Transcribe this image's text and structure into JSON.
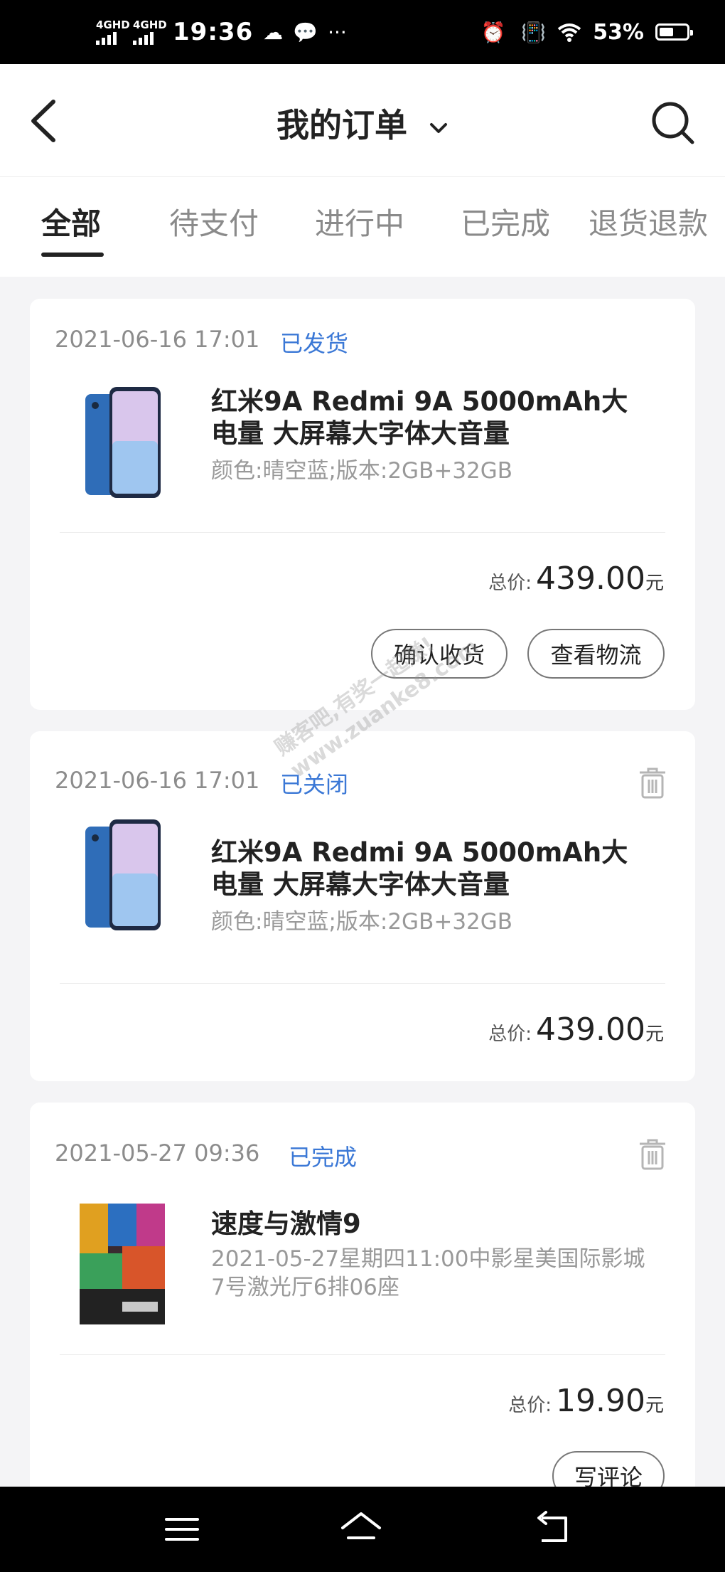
{
  "status_bar": {
    "net1": "4GHD",
    "net2": "4GHD",
    "time": "19:36",
    "battery": "53%"
  },
  "header": {
    "title": "我的订单"
  },
  "tabs": [
    {
      "label": "全部",
      "active": true
    },
    {
      "label": "待支付"
    },
    {
      "label": "进行中"
    },
    {
      "label": "已完成"
    },
    {
      "label": "退货退款"
    }
  ],
  "orders": [
    {
      "date": "2021-06-16 17:01",
      "status": "已发货",
      "name": "红米9A Redmi 9A  5000mAh大电量 大屏幕大字体大音量",
      "spec": "颜色:晴空蓝;版本:2GB+32GB",
      "total_label": "总价:",
      "total": "439.00",
      "unit": "元",
      "buttons": [
        "确认收货",
        "查看物流"
      ]
    },
    {
      "date": "2021-06-16 17:01",
      "status": "已关闭",
      "name": "红米9A Redmi 9A  5000mAh大电量 大屏幕大字体大音量",
      "spec": "颜色:晴空蓝;版本:2GB+32GB",
      "total_label": "总价:",
      "total": "439.00",
      "unit": "元"
    },
    {
      "date": "2021-05-27 09:36",
      "status": "已完成",
      "name": "速度与激情9",
      "spec": "2021-05-27星期四11:00中影星美国际影城7号激光厅6排06座",
      "total_label": "总价:",
      "total": "19.90",
      "unit": "元",
      "buttons": [
        "写评论"
      ]
    }
  ],
  "watermark": {
    "line1": "赚客吧,有奖一起赚!",
    "line2": "www.zuanke8.com"
  },
  "colors": {
    "status_blue": "#3b78d6",
    "text_dark": "#222222",
    "text_gray": "#999999",
    "background": "#f4f4f6"
  },
  "icons": [
    "back-arrow-icon",
    "chevron-down-icon",
    "search-icon",
    "trash-icon",
    "menu-icon",
    "home-icon",
    "back-nav-icon"
  ]
}
